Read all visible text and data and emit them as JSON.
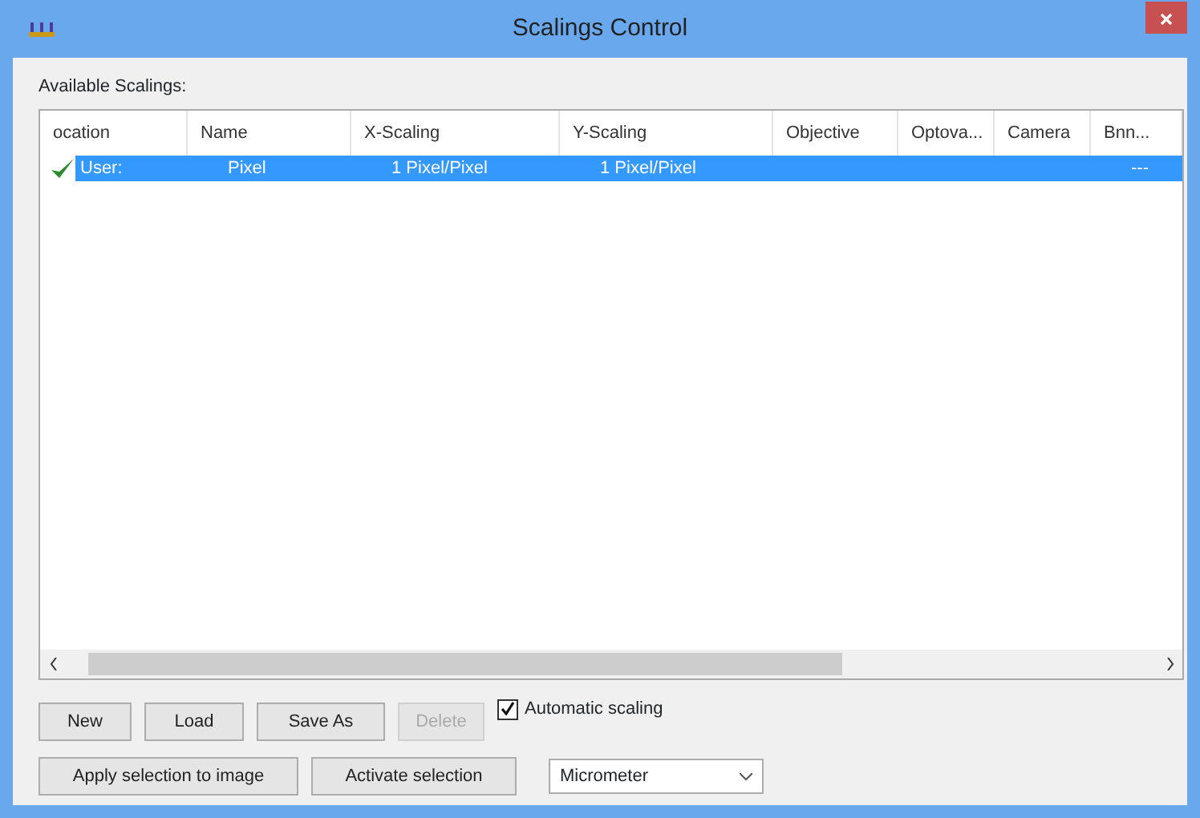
{
  "window": {
    "title": "Scalings Control"
  },
  "table": {
    "label": "Available Scalings:",
    "columns": [
      "ocation",
      "Name",
      "X-Scaling",
      "Y-Scaling",
      "Objective",
      "Optova...",
      "Camera",
      "Bnn..."
    ],
    "rows": [
      {
        "active": true,
        "selected": true,
        "cells": [
          "User:",
          "Pixel",
          "1 Pixel/Pixel",
          "1 Pixel/Pixel",
          "",
          "",
          "",
          "---"
        ]
      }
    ]
  },
  "buttons": [
    {
      "label": "New",
      "disabled": false
    },
    {
      "label": "Load",
      "disabled": false
    },
    {
      "label": "Save As",
      "disabled": false
    },
    {
      "label": "Delete",
      "disabled": true
    }
  ],
  "automatic_scaling": {
    "label": "Automatic scaling",
    "checked": true
  },
  "actions": [
    "Apply selection to image",
    "Activate selection"
  ],
  "unit": {
    "value": "Micrometer"
  }
}
